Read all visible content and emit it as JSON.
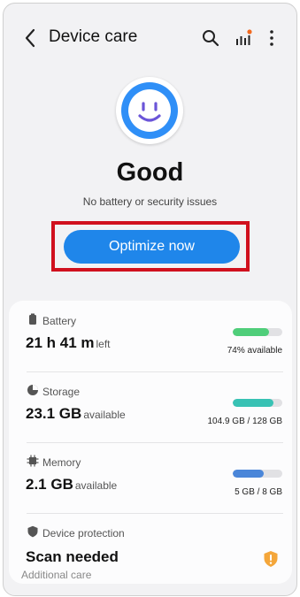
{
  "header": {
    "title": "Device care",
    "back_icon": "back-arrow-icon",
    "search_icon": "search-icon",
    "stats_icon": "signal-bars-icon",
    "menu_icon": "more-vertical-icon"
  },
  "hero": {
    "status": "Good",
    "message": "No battery or security issues",
    "button_label": "Optimize now"
  },
  "items": [
    {
      "label": "Battery",
      "value": "21 h 41 m",
      "unit": "left",
      "meta": "74% available",
      "fill_percent": 74,
      "color": "#4fce7a"
    },
    {
      "label": "Storage",
      "value": "23.1 GB",
      "unit": "available",
      "meta": "104.9 GB / 128 GB",
      "fill_percent": 82,
      "color": "#38c2b4"
    },
    {
      "label": "Memory",
      "value": "2.1 GB",
      "unit": "available",
      "meta": "5 GB / 8 GB",
      "fill_percent": 62,
      "color": "#4a86d9"
    }
  ],
  "protection": {
    "label": "Device protection",
    "status": "Scan needed",
    "warning_color": "#f4a63a"
  },
  "footer": {
    "partial_label": "Additional care"
  },
  "colors": {
    "accent": "#1f86ea",
    "highlight": "#d0101e",
    "notification_dot": "#f26b21"
  }
}
